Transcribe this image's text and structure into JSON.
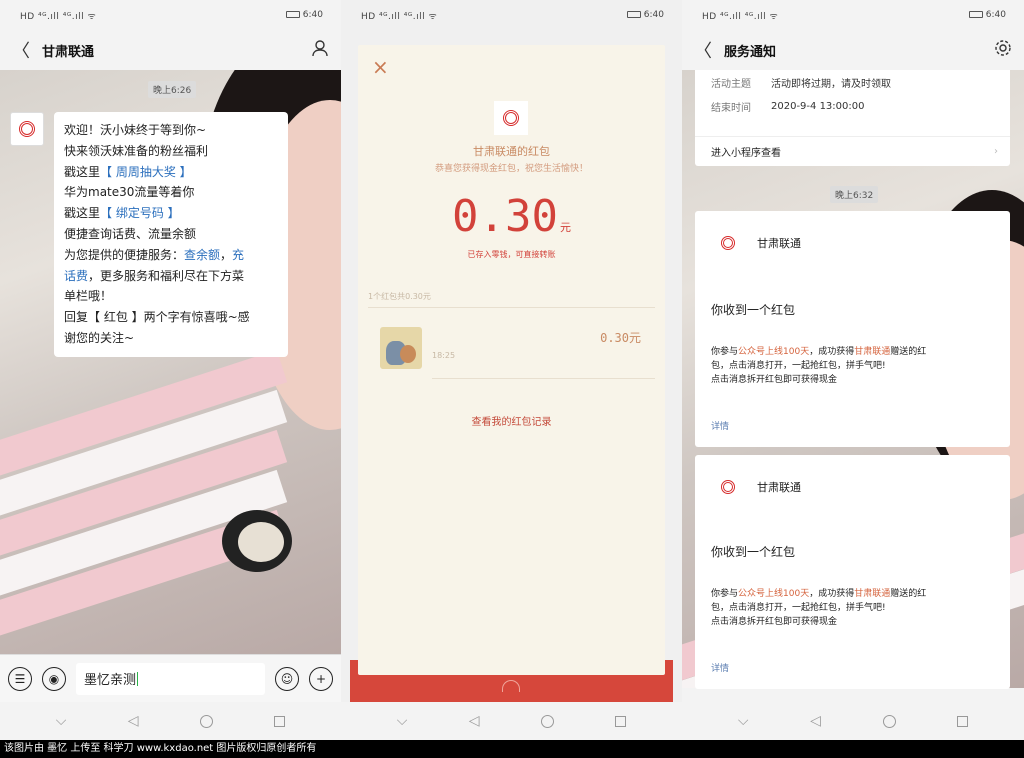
{
  "status": {
    "left": "HD ⁴ᴳ.ıll ⁴ᴳ.ıll ᯤ",
    "p1_time": "6:40",
    "p2_time": "6:40",
    "p3_time": "6:40"
  },
  "chat": {
    "title": "甘肃联通",
    "back": "〈",
    "profile_icon": "person-icon",
    "time_label": "晚上6:26",
    "message": {
      "l1": "欢迎！沃小妹终于等到你~",
      "l2": "快来领沃妹准备的粉丝福利",
      "l3a": "戳这里",
      "l3b": "【 周周抽大奖 】",
      "l4": "华为mate30流量等着你",
      "l5a": "戳这里",
      "l5b": "【 绑定号码 】",
      "l6": "便捷查询话费、流量余额",
      "l7a": "为您提供的便捷服务：",
      "l7b": "查余额",
      "l7c": "，",
      "l7d": "充",
      "l8a": "话费",
      "l8b": "，更多服务和福利尽在下方菜",
      "l9": "单栏哦！",
      "l10": "回复【 红包 】两个字有惊喜哦~感",
      "l11": "谢您的关注~"
    },
    "input_value": "墨忆亲测"
  },
  "packet": {
    "close": "×",
    "title": "甘肃联通的红包",
    "subtitle": "恭喜您获得现金红包，祝您生活愉快！",
    "amount": "0.30",
    "unit": "元",
    "note": "已存入零钱，可直接转账",
    "count": "1个红包共0.30元",
    "row_time": "18:25",
    "row_amount": "0.30元",
    "record_link": "查看我的红包记录"
  },
  "notice": {
    "title": "服务通知",
    "back": "〈",
    "card0": {
      "k1": "活动主题",
      "v1": "活动即将过期，请及时领取",
      "k2": "结束时间",
      "v2": "2020-9-4 13:00:00",
      "mini": "进入小程序查看"
    },
    "time_label": "晚上6:32",
    "card1": {
      "sender": "甘肃联通",
      "title": "你收到一个红包",
      "b1a": "你参与",
      "b1b": "公众号上线100天",
      "b1c": "，成功获得",
      "b1d": "甘肃联通",
      "b1e": "赠送的红",
      "b2": "包，点击消息打开，一起抢红包，拼手气吧!",
      "b3": "点击消息拆开红包即可获得现金",
      "detail": "详情"
    },
    "card2": {
      "sender": "甘肃联通",
      "title": "你收到一个红包",
      "b1a": "你参与",
      "b1b": "公众号上线100天",
      "b1c": "，成功获得",
      "b1d": "甘肃联通",
      "b1e": "赠送的红",
      "b2": "包，点击消息打开，一起抢红包，拼手气吧!",
      "b3": "点击消息拆开红包即可获得现金",
      "detail": "详情"
    }
  },
  "caption": "该图片由 墨忆 上传至 科学刀 www.kxdao.net 图片版权归原创者所有",
  "colors": {
    "accent_red": "#d2423a",
    "link_blue": "#2b6fbd",
    "packet_bg": "#f8f4e9"
  }
}
